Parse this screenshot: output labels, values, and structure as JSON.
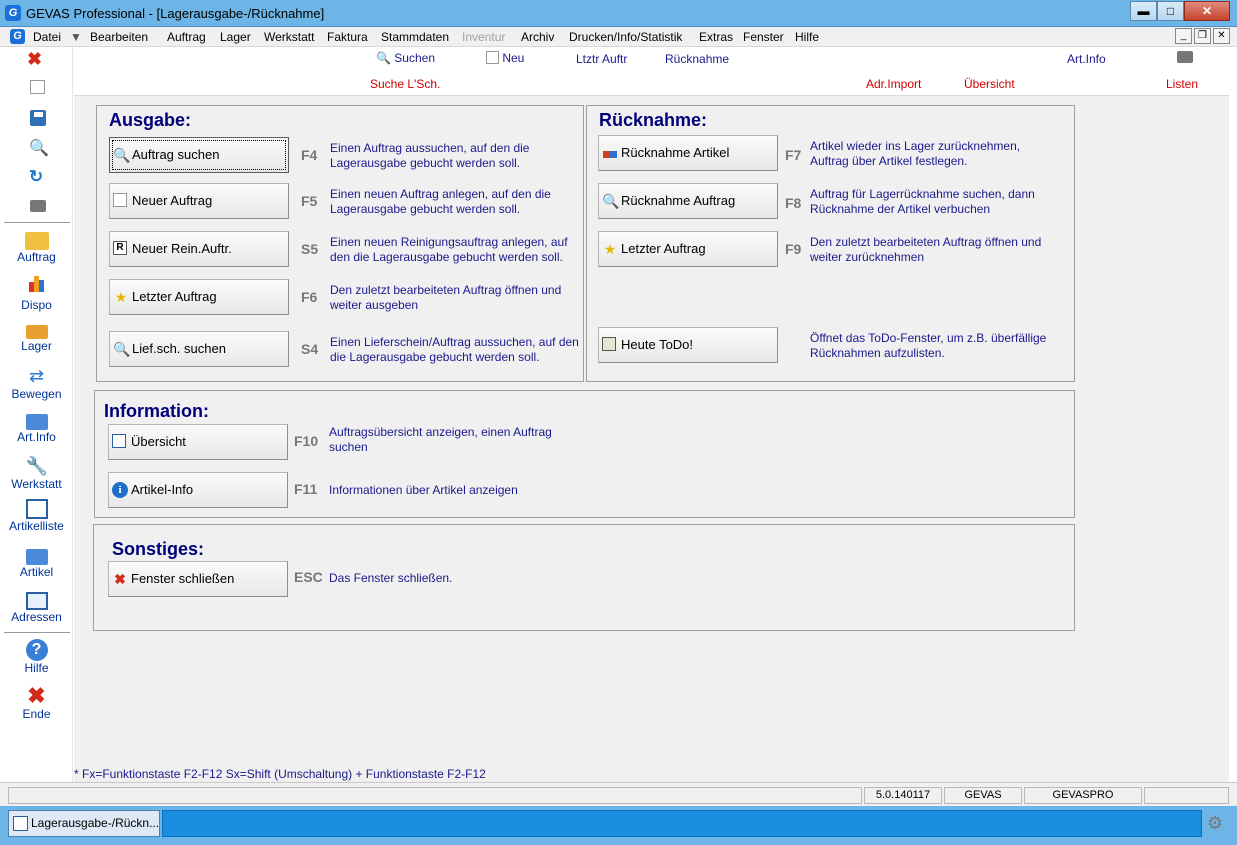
{
  "window": {
    "title": "GEVAS Professional - [Lagerausgabe-/Rücknahme]"
  },
  "menu": [
    "Datei",
    "Bearbeiten",
    "Auftrag",
    "Lager",
    "Werkstatt",
    "Faktura",
    "Stammdaten",
    "Inventur",
    "Archiv",
    "Drucken/Info/Statistik",
    "Extras",
    "Fenster",
    "Hilfe"
  ],
  "menu_disabled": [
    "Inventur"
  ],
  "toolbar": {
    "search": "Suchen",
    "new": "Neu",
    "last_order": "Ltztr Auftr",
    "return": "Rücknahme",
    "art_info": "Art.Info",
    "search_ls": "Suche L'Sch.",
    "adr_import": "Adr.Import",
    "overview": "Übersicht",
    "lists": "Listen"
  },
  "sidebar": {
    "tools": [
      "close-icon",
      "blank-icon",
      "save-icon",
      "search-icon",
      "refresh-icon",
      "print-icon"
    ],
    "items": [
      {
        "label": "Auftrag",
        "icon": "order-folder-icon"
      },
      {
        "label": "Dispo",
        "icon": "dispo-chart-icon"
      },
      {
        "label": "Lager",
        "icon": "truck-icon"
      },
      {
        "label": "Bewegen",
        "icon": "move-icon"
      },
      {
        "label": "Art.Info",
        "icon": "article-info-icon"
      },
      {
        "label": "Werkstatt",
        "icon": "wrench-icon"
      },
      {
        "label": "Artikelliste",
        "icon": "list-icon"
      },
      {
        "label": "Artikel",
        "icon": "article-icon"
      },
      {
        "label": "Adressen",
        "icon": "address-card-icon"
      }
    ],
    "help": "Hilfe",
    "end": "Ende"
  },
  "ausgabe": {
    "title": "Ausgabe:",
    "rows": [
      {
        "button": "Auftrag suchen",
        "key": "F4",
        "desc": "Einen Auftrag aussuchen, auf den die Lagerausgabe gebucht  werden soll.",
        "icon": "search-icon"
      },
      {
        "button": "Neuer Auftrag",
        "key": "F5",
        "desc": "Einen neuen Auftrag anlegen, auf den die Lagerausgabe gebucht  werden soll.",
        "icon": "blank-icon"
      },
      {
        "button": "Neuer Rein.Auftr.",
        "key": "S5",
        "desc": "Einen neuen Reinigungsauftrag anlegen, auf den die Lagerausgabe gebucht  werden soll.",
        "icon": "r-box-icon"
      },
      {
        "button": "Letzter Auftrag",
        "key": "F6",
        "desc": "Den zuletzt bearbeiteten Auftrag öffnen und weiter ausgeben",
        "icon": "star-icon"
      },
      {
        "button": "Lief.sch. suchen",
        "key": "S4",
        "desc": "Einen Lieferschein/Auftrag aussuchen, auf den die Lagerausgabe gebucht  werden soll.",
        "icon": "search-icon"
      }
    ]
  },
  "ruecknahme": {
    "title": "Rücknahme:",
    "rows": [
      {
        "button": "Rücknahme Artikel",
        "key": "F7",
        "desc": "Artikel wieder ins Lager zurücknehmen, Auftrag über Artikel festlegen.",
        "icon": "boxes-icon"
      },
      {
        "button": "Rücknahme Auftrag",
        "key": "F8",
        "desc": "Auftrag für Lagerrücknahme suchen, dann Rücknahme der Artikel verbuchen",
        "icon": "search-icon"
      },
      {
        "button": "Letzter Auftrag",
        "key": "F9",
        "desc": "Den zuletzt bearbeiteten Auftrag öffnen und weiter zurücknehmen",
        "icon": "star-icon"
      },
      {
        "button": "Heute ToDo!",
        "key": "",
        "desc": "Öffnet das ToDo-Fenster, um z.B. überfällige Rücknahmen aufzulisten.",
        "icon": "todo-icon"
      }
    ]
  },
  "information": {
    "title": "Information:",
    "rows": [
      {
        "button": "Übersicht",
        "key": "F10",
        "desc": "Auftragsübersicht anzeigen, einen Auftrag suchen",
        "icon": "list-icon"
      },
      {
        "button": "Artikel-Info",
        "key": "F11",
        "desc": "Informationen über Artikel anzeigen",
        "icon": "info-icon"
      }
    ]
  },
  "sonstiges": {
    "title": "Sonstiges:",
    "rows": [
      {
        "button": "Fenster schließen",
        "key": "ESC",
        "desc": "Das Fenster schließen.",
        "icon": "close-icon"
      }
    ]
  },
  "footer_note": "* Fx=Funktionstaste F2-F12   Sx=Shift (Umschaltung) + Funktionstaste F2-F12",
  "status": {
    "version": "5.0.140117",
    "company": "GEVAS",
    "user": "GEVASPRO"
  },
  "taskbar": {
    "window_label": "Lagerausgabe-/Rückn..."
  },
  "colors": {
    "accent": "#6cb5e6",
    "heading": "#00007a",
    "desc": "#1a1a8c",
    "red": "#d00000"
  }
}
